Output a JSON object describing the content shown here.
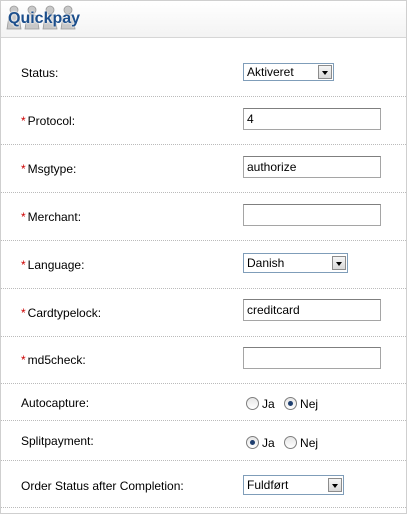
{
  "panel": {
    "title": "Quickpay",
    "icon": "people-group-icon"
  },
  "fields": {
    "status": {
      "label": "Status:",
      "required": false,
      "value": "Aktiveret"
    },
    "protocol": {
      "label": "Protocol:",
      "required": true,
      "value": "4"
    },
    "msgtype": {
      "label": "Msgtype:",
      "required": true,
      "value": "authorize"
    },
    "merchant": {
      "label": "Merchant:",
      "required": true,
      "value": ""
    },
    "language": {
      "label": "Language:",
      "required": true,
      "value": "Danish"
    },
    "cardtypelock": {
      "label": "Cardtypelock:",
      "required": true,
      "value": "creditcard"
    },
    "md5check": {
      "label": "md5check:",
      "required": true,
      "value": ""
    },
    "autocapture": {
      "label": "Autocapture:",
      "required": false,
      "options": [
        "Ja",
        "Nej"
      ],
      "selected": "Nej"
    },
    "splitpayment": {
      "label": "Splitpayment:",
      "required": false,
      "options": [
        "Ja",
        "Nej"
      ],
      "selected": "Ja"
    },
    "order_status": {
      "label": "Order Status after Completion:",
      "required": false,
      "value": "Fuldført"
    }
  },
  "required_marker": "*",
  "colors": {
    "title": "#1d4f8c",
    "required": "#cc0000"
  }
}
